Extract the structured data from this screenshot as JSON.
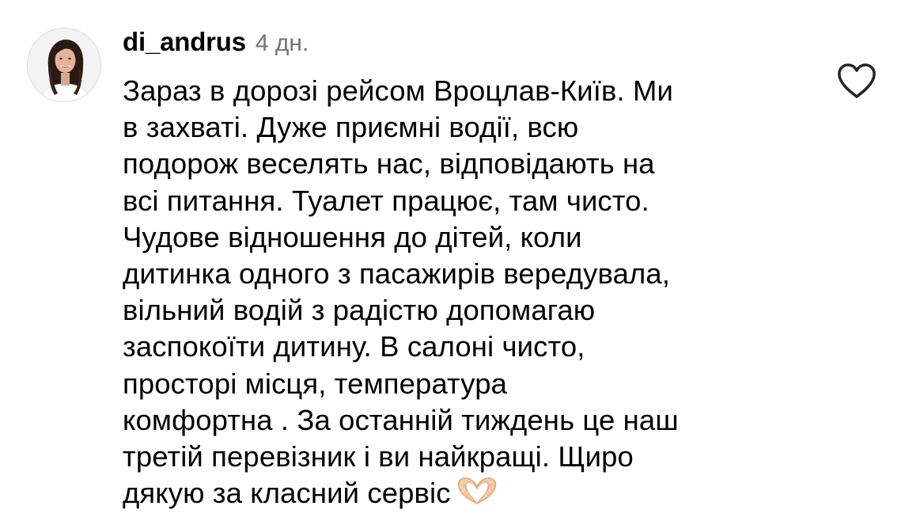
{
  "comment": {
    "author": {
      "username": "di_andrus",
      "avatar_icon": "profile-photo"
    },
    "timestamp": "4 дн.",
    "text": "Зараз в дорозі рейсом Вроцлав-Київ. Ми\nв захваті. Дуже приємні водії, всю\nподорож веселять нас, відповідають на\nвсі питання. Туалет працює, там чисто.\nЧудове відношення до дітей, коли\nдитинка одного з пасажирів вередувала,\nвільний водій з радістю допомагаю\nзаспокоїти дитину. В салоні чисто,\nпросторі місця, температура\nкомфортна . За останній тиждень це наш\nтретій перевізник і ви найкращі. Щиро\nдякую за класний сервіс",
    "emoji": "heart-hands-icon",
    "like_icon": "heart-outline-icon"
  },
  "colors": {
    "text": "#000000",
    "timestamp": "#737373",
    "background": "#ffffff"
  }
}
